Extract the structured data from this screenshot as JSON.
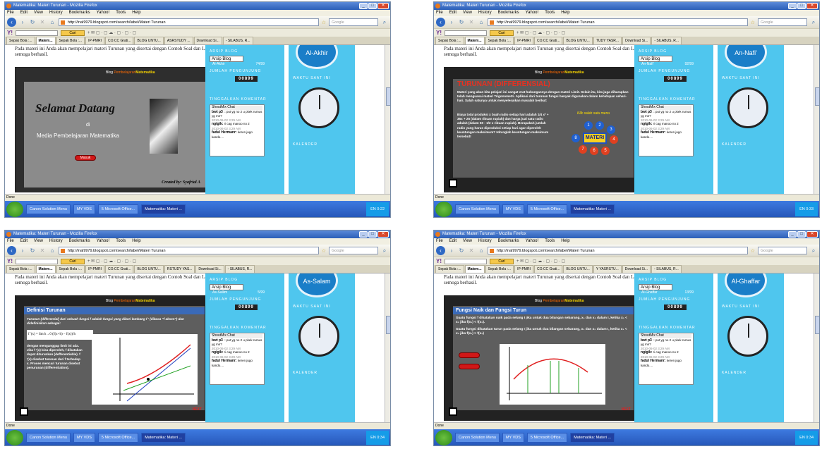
{
  "browser": {
    "window_title": "Matematika: Materi Turunan - Mozilla Firefox",
    "menu": [
      "File",
      "Edit",
      "View",
      "History",
      "Bookmarks",
      "Yahoo!",
      "Tools",
      "Help"
    ],
    "url": "http://inal9979.blogspot.com/search/label/Materi Turunan",
    "search_placeholder": "Google",
    "yahoo_button": "Cari",
    "status": "Done"
  },
  "blog": {
    "intro": "Pada materi ini Anda akan mempelajari materi Turunan yang disertai dengan Contoh Soal dan Latihan. Selamat mencoba dan semoga berhasil.",
    "archive_heading": "ARSIP BLOG",
    "archive_select": "Arsip Blog",
    "visitors_heading": "JUMLAH PENGUNJUNG",
    "counter": "00899",
    "clock_heading": "WAKTU SAAT INI",
    "comment_heading": "TINGGALKAN KOMENTAR",
    "calendar_heading": "KALENDER",
    "slide_header_a": "Blog",
    "slide_header_b": "Pembelajaran",
    "slide_header_c": "Matematika",
    "chat": {
      "title": "ShoutMix Chat",
      "m1_name": "bwt p3",
      "m1_text": ":: put yg no 2 u pkek rumus yg mn?",
      "m1_time": "2010-06-02 3:29 AM",
      "m2_name": "ngigik:",
      "m2_text": "ri cag manoo no 2",
      "m2_time": "2010-06-02 3:29 AM",
      "m3_name": "fadul Hermanr:",
      "m3_text": "keren jugo kando...."
    }
  },
  "shots": [
    {
      "tabs": [
        "Sepak Bola :...",
        "Matem...",
        "Sepak Bola :...",
        "IP-PMRI",
        "CO.CC Grati...",
        "BLOG UNTU...",
        "ASRSTUDY ...",
        "Download Si...",
        "- SILABUS, R..."
      ],
      "slide_title": "Selamat Datang",
      "slide_di": "di",
      "slide_sub": "Media Pembelajaran Matematika",
      "slide_button": "Masuk",
      "slide_credit": "Created by: Syafrial A",
      "asma_name": "Al-Akhir",
      "asma_num": "74/99",
      "emblem": "Al-Akhir",
      "tasks": [
        "Canon Solution Menu",
        "MY VDS",
        "5 Microsoft Office...",
        "Matematika: Materi ..."
      ],
      "tray": "EN 0:22"
    },
    {
      "tabs": [
        "Sepak Bola :...",
        "Matem...",
        "Sepak Bola :...",
        "IP-PMRI",
        "CO.CC Grati...",
        "BLOG UNTU...",
        "TUDY YASR...",
        "Download Si...",
        "- SILABUS, R..."
      ],
      "slide_title": "TURUNAN (DIFFERENSIAL)",
      "slide_text": "Materi yang akan kita pelajari ini sangat erat hubungannya dengan materi Limit. Selain itu, kita juga diharapkan telah menguasai materi Trigonometri. Aplikasi dari turunan fungsi banyak digunakan dalam kehidupan sehari-hari. Salah satunya untuk menyelesaikan masalah berikut:",
      "slide_text2": "Biaya total produksi x buah radio setiap hari adalah 1/4 x² + 35x + 25 (dalam ribuan rupiah) dan harga jual satu radio adalah (dalam 50 - 1/2 x ribuan rupiah). Berapakah jumlah radio yang harus diproduksi setiap hari agar diperoleh keuntungan maksimum? Hitunglah keuntungan maksimum tersebut!",
      "menu_hint": "Klik salah satu menu",
      "menu_center": "MATERI",
      "asma_name": "An-Nafi'",
      "asma_num": "92/99",
      "emblem": "An-Nafi'",
      "tasks": [
        "Canon Solution Menu",
        "MY VDS",
        "5 Microsoft Office...",
        "Matematika: Materi ..."
      ],
      "tray": "EN 0:33"
    },
    {
      "tabs": [
        "Sepak Bola :...",
        "Matem...",
        "Sepak Bola :...",
        "IP-PMRI",
        "CO.CC Grati...",
        "BLOG UNTU...",
        "RSTUDY YAS...",
        "Download Si...",
        "- SILABUS, R..."
      ],
      "slide_title": "Definisi Turunan",
      "slide_text": "Turunan (differential) dari sebuah fungsi f adalah fungsi yang diberi lambang f ' (dibaca \"f aksen\") dan didefinisikan sebagai:",
      "slide_formula": "f '(x) = lim h→0 (f(x+h) − f(x))/h",
      "slide_text2": "dengan menganggap limit ini ada. Jika f '(x) bisa diperoleh, f dikatakan dapat diturunkan (defferentiable). f '(x) disebut turunan dari f terhadap x. Proses mencari turunan disebut penurunan (differentiation).",
      "next": "NEXT",
      "asma_name": "As-Sallim",
      "asma_num": "5/99",
      "emblem": "As-Salam",
      "tasks": [
        "Canon Solution Menu",
        "MY VDS",
        "5 Microsoft Office...",
        "Matematika: Materi ..."
      ],
      "tray": "EN 0:34"
    },
    {
      "tabs": [
        "Sepak Bola :...",
        "Matem...",
        "Sepak Bola :...",
        "IP-PMRI",
        "CO.CC Grati...",
        "BLOG UNTU...",
        "Y YASRSTU...",
        "Download Si...",
        "- SILABUS, R..."
      ],
      "slide_title": "Fungsi Naik dan Fungsi Turun",
      "slide_text": "Suatu fungsi f dikatakan naik pada selang I jika untuk dua bilangan sebarang, x₁ dan x₂ dalam I, ketika x₁ < x₂ jika f(x₁) < f(x₂).",
      "slide_text2": "Suatu fungsi dikatakan turun pada selang I jika untuk dua bilangan sebarang, x₁ dan x₂ dalam I, ketika x₁ < x₂ jika f(x₁) > f(x₂)",
      "next": "NEXT",
      "asma_name": "Al-Ghaffar",
      "asma_num": "13/99",
      "emblem": "Al-Ghaffar",
      "tasks": [
        "Canon Solution Menu",
        "MY VDS",
        "5 Microsoft Office...",
        "Matematika: Materi ..."
      ],
      "tray": "EN 0:34"
    }
  ]
}
